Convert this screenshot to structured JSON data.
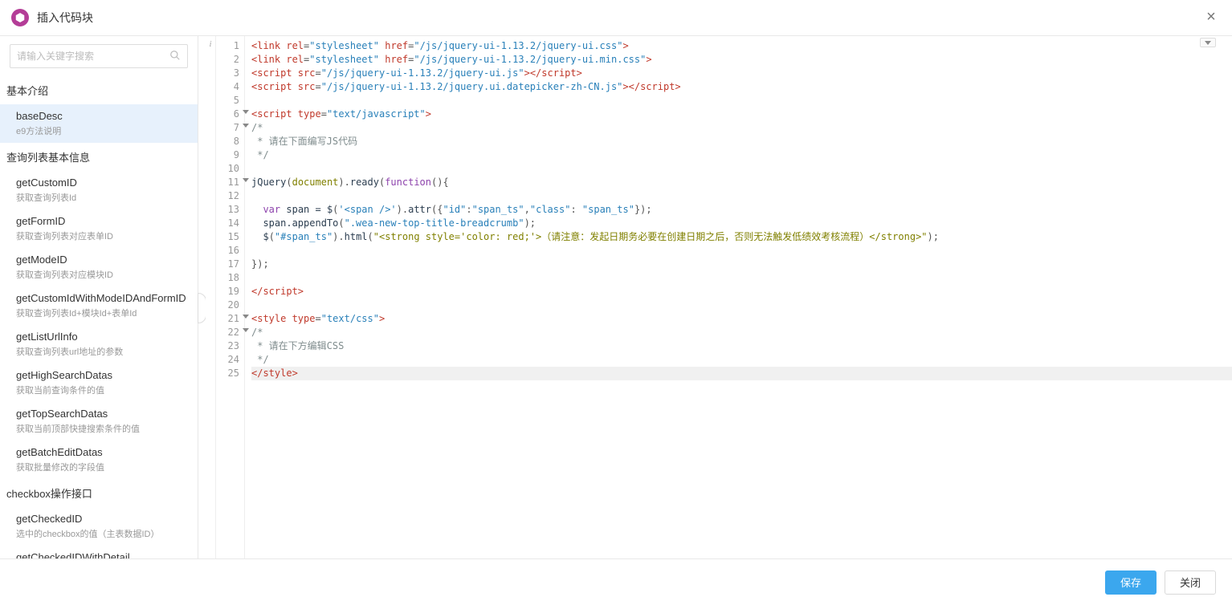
{
  "header": {
    "title": "插入代码块"
  },
  "search": {
    "placeholder": "请输入关键字搜索"
  },
  "sidebar": [
    {
      "header": "基本介绍",
      "items": [
        {
          "title": "baseDesc",
          "desc": "e9方法说明",
          "selected": true
        }
      ]
    },
    {
      "header": "查询列表基本信息",
      "items": [
        {
          "title": "getCustomID",
          "desc": "获取查询列表Id"
        },
        {
          "title": "getFormID",
          "desc": "获取查询列表对应表单ID"
        },
        {
          "title": "getModeID",
          "desc": "获取查询列表对应模块ID"
        },
        {
          "title": "getCustomIdWithModeIDAndFormID",
          "desc": "获取查询列表Id+模块Id+表单Id"
        },
        {
          "title": "getListUrlInfo",
          "desc": "获取查询列表url地址的参数"
        },
        {
          "title": "getHighSearchDatas",
          "desc": "获取当前查询条件的值"
        },
        {
          "title": "getTopSearchDatas",
          "desc": "获取当前顶部快捷搜索条件的值"
        },
        {
          "title": "getBatchEditDatas",
          "desc": "获取批量修改的字段值"
        }
      ]
    },
    {
      "header": "checkbox操作接口",
      "items": [
        {
          "title": "getCheckedID",
          "desc": "选中的checkbox的值（主表数据ID）"
        },
        {
          "title": "getCheckedIDWithDetail",
          "desc": ""
        }
      ]
    }
  ],
  "code": {
    "lines": [
      {
        "n": 1,
        "fold": false,
        "seg": [
          [
            "<link ",
            "t-tag"
          ],
          [
            "rel",
            "t-attr"
          ],
          [
            "=",
            "t-punct"
          ],
          [
            "\"stylesheet\"",
            "t-str"
          ],
          [
            " ",
            ""
          ],
          [
            "href",
            "t-attr"
          ],
          [
            "=",
            "t-punct"
          ],
          [
            "\"/js/jquery-ui-1.13.2/jquery-ui.css\"",
            "t-str"
          ],
          [
            ">",
            "t-tag"
          ]
        ]
      },
      {
        "n": 2,
        "fold": false,
        "seg": [
          [
            "<link ",
            "t-tag"
          ],
          [
            "rel",
            "t-attr"
          ],
          [
            "=",
            "t-punct"
          ],
          [
            "\"stylesheet\"",
            "t-str"
          ],
          [
            " ",
            ""
          ],
          [
            "href",
            "t-attr"
          ],
          [
            "=",
            "t-punct"
          ],
          [
            "\"/js/jquery-ui-1.13.2/jquery-ui.min.css\"",
            "t-str"
          ],
          [
            ">",
            "t-tag"
          ]
        ]
      },
      {
        "n": 3,
        "fold": false,
        "seg": [
          [
            "<script ",
            "t-tag"
          ],
          [
            "src",
            "t-attr"
          ],
          [
            "=",
            "t-punct"
          ],
          [
            "\"/js/jquery-ui-1.13.2/jquery-ui.js\"",
            "t-str"
          ],
          [
            "></script>",
            "t-tag"
          ]
        ]
      },
      {
        "n": 4,
        "fold": false,
        "seg": [
          [
            "<script ",
            "t-tag"
          ],
          [
            "src",
            "t-attr"
          ],
          [
            "=",
            "t-punct"
          ],
          [
            "\"/js/jquery-ui-1.13.2/jquery.ui.datepicker-zh-CN.js\"",
            "t-str"
          ],
          [
            "></script>",
            "t-tag"
          ]
        ]
      },
      {
        "n": 5,
        "fold": false,
        "seg": [
          [
            "",
            ""
          ]
        ]
      },
      {
        "n": 6,
        "fold": true,
        "seg": [
          [
            "<script ",
            "t-tag"
          ],
          [
            "type",
            "t-attr"
          ],
          [
            "=",
            "t-punct"
          ],
          [
            "\"text/javascript\"",
            "t-str"
          ],
          [
            ">",
            "t-tag"
          ]
        ]
      },
      {
        "n": 7,
        "fold": true,
        "seg": [
          [
            "/*",
            "t-comment"
          ]
        ]
      },
      {
        "n": 8,
        "fold": false,
        "seg": [
          [
            " * 请在下面编写JS代码",
            "t-comment"
          ]
        ]
      },
      {
        "n": 9,
        "fold": false,
        "seg": [
          [
            " */",
            "t-comment"
          ]
        ]
      },
      {
        "n": 10,
        "fold": false,
        "seg": [
          [
            "",
            ""
          ]
        ]
      },
      {
        "n": 11,
        "fold": true,
        "seg": [
          [
            "jQuery",
            "t-ident"
          ],
          [
            "(",
            "t-punct"
          ],
          [
            "document",
            "t-olive"
          ],
          [
            ").",
            "t-punct"
          ],
          [
            "ready",
            "t-ident"
          ],
          [
            "(",
            "t-punct"
          ],
          [
            "function",
            "t-kw"
          ],
          [
            "(){",
            "t-punct"
          ]
        ]
      },
      {
        "n": 12,
        "fold": false,
        "seg": [
          [
            "",
            ""
          ]
        ]
      },
      {
        "n": 13,
        "fold": false,
        "seg": [
          [
            "  ",
            ""
          ],
          [
            "var",
            "t-kw"
          ],
          [
            " span = ",
            "t-ident"
          ],
          [
            "$",
            "t-ident"
          ],
          [
            "(",
            "t-punct"
          ],
          [
            "'<span />'",
            "t-str"
          ],
          [
            ").",
            "t-punct"
          ],
          [
            "attr",
            "t-ident"
          ],
          [
            "({",
            "t-punct"
          ],
          [
            "\"id\"",
            "t-str"
          ],
          [
            ":",
            "t-punct"
          ],
          [
            "\"span_ts\"",
            "t-str"
          ],
          [
            ",",
            "t-punct"
          ],
          [
            "\"class\"",
            "t-str"
          ],
          [
            ": ",
            "t-punct"
          ],
          [
            "\"span_ts\"",
            "t-str"
          ],
          [
            "});",
            "t-punct"
          ]
        ]
      },
      {
        "n": 14,
        "fold": false,
        "seg": [
          [
            "  span.",
            "t-ident"
          ],
          [
            "appendTo",
            "t-ident"
          ],
          [
            "(",
            "t-punct"
          ],
          [
            "\".wea-new-top-title-breadcrumb\"",
            "t-str"
          ],
          [
            ");",
            "t-punct"
          ]
        ]
      },
      {
        "n": 15,
        "fold": false,
        "seg": [
          [
            "  ",
            ""
          ],
          [
            "$",
            "t-ident"
          ],
          [
            "(",
            "t-punct"
          ],
          [
            "\"#span_ts\"",
            "t-str"
          ],
          [
            ").",
            "t-punct"
          ],
          [
            "html",
            "t-ident"
          ],
          [
            "(",
            "t-punct"
          ],
          [
            "\"<strong style='color: red;'>（请注意：发起日期务必要在创建日期之后，否则无法触发低绩效考核流程）</strong>\"",
            "t-olive"
          ],
          [
            ");",
            "t-punct"
          ]
        ]
      },
      {
        "n": 16,
        "fold": false,
        "seg": [
          [
            "",
            ""
          ]
        ]
      },
      {
        "n": 17,
        "fold": false,
        "seg": [
          [
            "});",
            "t-punct"
          ]
        ]
      },
      {
        "n": 18,
        "fold": false,
        "seg": [
          [
            "",
            ""
          ]
        ]
      },
      {
        "n": 19,
        "fold": false,
        "seg": [
          [
            "</script>",
            "t-tag"
          ]
        ]
      },
      {
        "n": 20,
        "fold": false,
        "seg": [
          [
            "",
            ""
          ]
        ]
      },
      {
        "n": 21,
        "fold": true,
        "seg": [
          [
            "<style ",
            "t-tag"
          ],
          [
            "type",
            "t-attr"
          ],
          [
            "=",
            "t-punct"
          ],
          [
            "\"text/css\"",
            "t-str"
          ],
          [
            ">",
            "t-tag"
          ]
        ]
      },
      {
        "n": 22,
        "fold": true,
        "seg": [
          [
            "/*",
            "t-comment"
          ]
        ]
      },
      {
        "n": 23,
        "fold": false,
        "seg": [
          [
            " * 请在下方编辑CSS",
            "t-comment"
          ]
        ]
      },
      {
        "n": 24,
        "fold": false,
        "seg": [
          [
            " */",
            "t-comment"
          ]
        ]
      },
      {
        "n": 25,
        "fold": false,
        "hl": true,
        "seg": [
          [
            "</style>",
            "t-tag"
          ]
        ]
      }
    ]
  },
  "footer": {
    "save": "保存",
    "close": "关闭"
  }
}
